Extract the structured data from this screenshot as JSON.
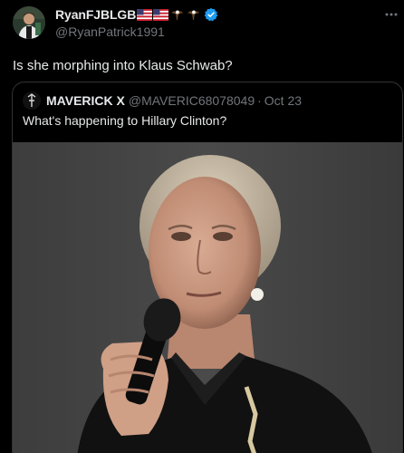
{
  "tweet": {
    "display_name": "RyanFJBLGB",
    "handle": "@RyanPatrick1991",
    "text": "Is she morphing into Klaus Schwab?",
    "more_icon": "more-horizontal-icon",
    "verified_icon": "verified-badge-icon",
    "emoji_icons": [
      "us-flag-icon",
      "us-flag-icon",
      "eagle-icon",
      "eagle-icon"
    ]
  },
  "quoted": {
    "display_name": "MAVERICK X",
    "handle": "@MAVERIC68078049",
    "separator": "·",
    "date": "Oct 23",
    "text": "What's happening to Hillary Clinton?",
    "image_icon": "photo-of-woman-with-microphone"
  },
  "colors": {
    "background": "#000000",
    "text": "#e7e9ea",
    "muted": "#71767b",
    "verified": "#1d9bf0",
    "border": "#2f3336"
  }
}
